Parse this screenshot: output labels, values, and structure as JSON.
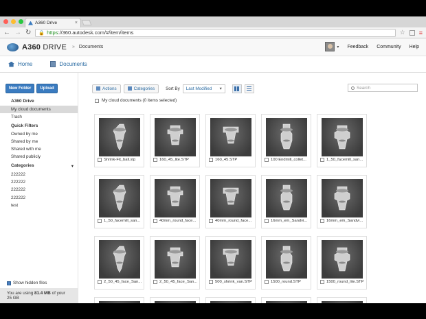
{
  "browser": {
    "tab_title": "A360 Drive",
    "url_scheme": "https",
    "url_rest": "://360.autodesk.com/#/item/items",
    "colors": {
      "traffic_red": "#ff5f57",
      "traffic_yellow": "#febc2e",
      "traffic_green": "#28c840"
    }
  },
  "header": {
    "brand_a": "A360",
    "brand_b": " DRIVE",
    "breadcrumb": "Documents",
    "links": {
      "feedback": "Feedback",
      "community": "Community",
      "help": "Help"
    }
  },
  "nav": {
    "home": "Home",
    "documents": "Documents"
  },
  "sidebar": {
    "new_folder": "New Folder",
    "upload": "Upload",
    "drive_heading": "A360 Drive",
    "my_cloud": "My cloud documents",
    "trash": "Trash",
    "quick_filters": "Quick Filters",
    "owned": "Owned by me",
    "shared_by": "Shared by me",
    "shared_with": "Shared with me",
    "shared_public": "Shared publicly",
    "categories": "Categories",
    "cats": [
      "222222",
      "222222",
      "222222",
      "222222",
      "test"
    ],
    "show_hidden": "Show hidden files",
    "quota_prefix": "You are using ",
    "quota_value": "81.4 MB",
    "quota_suffix": " of your 25 GB"
  },
  "toolbar": {
    "actions": "Actions",
    "categories": "Categories",
    "sort_by": "Sort By",
    "sort_value": "Last Modified",
    "search_placeholder": "Search"
  },
  "selection_text": "My cloud documents (0 items selected)",
  "files": [
    "Shrink-Fit_ball.stp",
    "160_45_lite.STP",
    "160_45.STP",
    "100 Endmill_collet...",
    "1_50_facemill_san...",
    "1_50_facemill_san...",
    "40mm_round_face...",
    "40mm_round_face...",
    "16mm_em_Sandvi...",
    "16mm_em_Sandvi...",
    "2_50_45_face_San...",
    "2_50_45_face_San...",
    "500_shrink_van.STP",
    "1500_round.STP",
    "1500_round_lite.STP"
  ]
}
